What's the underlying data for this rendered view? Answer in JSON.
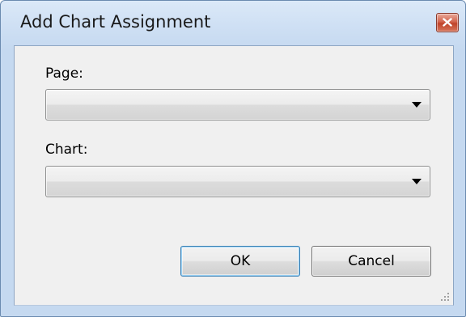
{
  "window": {
    "title": "Add Chart Assignment"
  },
  "form": {
    "page_label": "Page:",
    "page_value": "",
    "chart_label": "Chart:",
    "chart_value": ""
  },
  "buttons": {
    "ok_label": "OK",
    "cancel_label": "Cancel"
  },
  "icons": {
    "close": "close-icon",
    "dropdown": "chevron-down-icon",
    "resize": "resize-grip-icon"
  },
  "colors": {
    "titlebar": "#cfe0f4",
    "client": "#f0f0f0",
    "close_button": "#c74a32",
    "default_button_border": "#3c7fb1"
  }
}
